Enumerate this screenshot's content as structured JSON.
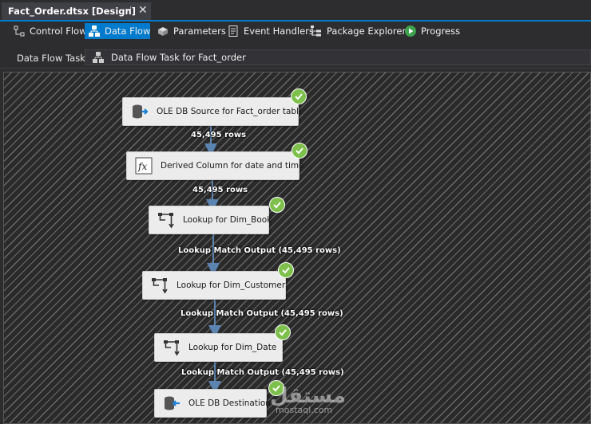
{
  "document_tab": {
    "title": "Fact_Order.dtsx [Design]",
    "pin_glyph": "⊣",
    "close_glyph": "✕"
  },
  "designer_tabs": [
    {
      "label": "Control Flow",
      "icon": "control-flow-icon",
      "active": false
    },
    {
      "label": "Data Flow",
      "icon": "data-flow-icon",
      "active": true
    },
    {
      "label": "Parameters",
      "icon": "parameters-icon",
      "active": false
    },
    {
      "label": "Event Handlers",
      "icon": "event-handlers-icon",
      "active": false
    },
    {
      "label": "Package Explorer",
      "icon": "package-explorer-icon",
      "active": false
    },
    {
      "label": "Progress",
      "icon": "progress-play-icon",
      "active": false
    }
  ],
  "task_bar": {
    "label": "Data Flow Task:",
    "selected": "Data Flow Task for Fact_order"
  },
  "components": [
    {
      "label": "OLE DB Source for Fact_order table",
      "icon": "ole-db-source-icon",
      "status": "success"
    },
    {
      "label": "Derived Column for date and time",
      "icon": "derived-column-fx-icon",
      "status": "success"
    },
    {
      "label": "Lookup for Dim_Book",
      "icon": "lookup-icon",
      "status": "success"
    },
    {
      "label": "Lookup for Dim_Customer",
      "icon": "lookup-icon",
      "status": "success"
    },
    {
      "label": "Lookup for Dim_Date",
      "icon": "lookup-icon",
      "status": "success"
    },
    {
      "label": "OLE DB Destination",
      "icon": "ole-db-destination-icon",
      "status": "success"
    }
  ],
  "paths": [
    {
      "label": "45,495 rows"
    },
    {
      "label": "45,495 rows"
    },
    {
      "label": "Lookup Match Output (45,495 rows)"
    },
    {
      "label": "Lookup Match Output (45,495 rows)"
    },
    {
      "label": "Lookup Match Output (45,495 rows)"
    }
  ],
  "watermark": {
    "text": "مستقل",
    "url": "mostaql.com"
  },
  "colors": {
    "accent": "#007acc",
    "success": "#7dc04b",
    "connector": "#5b84b1"
  }
}
